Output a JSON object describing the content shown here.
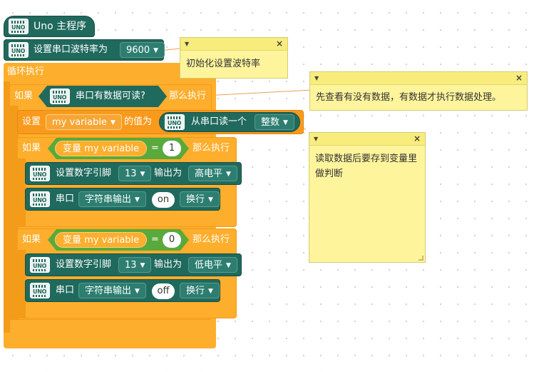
{
  "program": {
    "main_title": "Uno 主程序",
    "chip_label": "UNO",
    "set_baud_label": "设置串口波特率为",
    "baud_value": "9600",
    "loop_label": "循环执行",
    "if1": {
      "if_label": "如果",
      "condition": "串口有数据可读?",
      "then_label": "那么执行"
    },
    "set_var": {
      "set_label": "设置",
      "var_name": "my variable",
      "value_of_label": "的值为",
      "read_label": "从串口读一个",
      "type_value": "整数"
    },
    "if2": {
      "if_label": "如果",
      "var_prefix": "变量",
      "var_name": "my variable",
      "op": "=",
      "compare_value": "1",
      "then_label": "那么执行",
      "set_pin_label": "设置数字引脚",
      "pin": "13",
      "output_label": "输出为",
      "level": "高电平",
      "serial_label": "串口",
      "print_mode": "字符串输出",
      "print_value": "on",
      "newline": "换行"
    },
    "if3": {
      "if_label": "如果",
      "var_prefix": "变量",
      "var_name": "my variable",
      "op": "=",
      "compare_value": "0",
      "then_label": "那么执行",
      "set_pin_label": "设置数字引脚",
      "pin": "13",
      "output_label": "输出为",
      "level": "低电平",
      "serial_label": "串口",
      "print_mode": "字符串输出",
      "print_value": "off",
      "newline": "换行"
    }
  },
  "comments": [
    {
      "text": "初始化设置波特率",
      "close": "×"
    },
    {
      "text": "先查看有没有数据，有数据才执行数据处理。",
      "close": "×"
    },
    {
      "text": "读取数据后要存到变量里做判断",
      "close": "×"
    }
  ],
  "colors": {
    "green_block": "#20695d",
    "orange_block": "#fdae2c",
    "comment_bg": "#fef49c"
  }
}
